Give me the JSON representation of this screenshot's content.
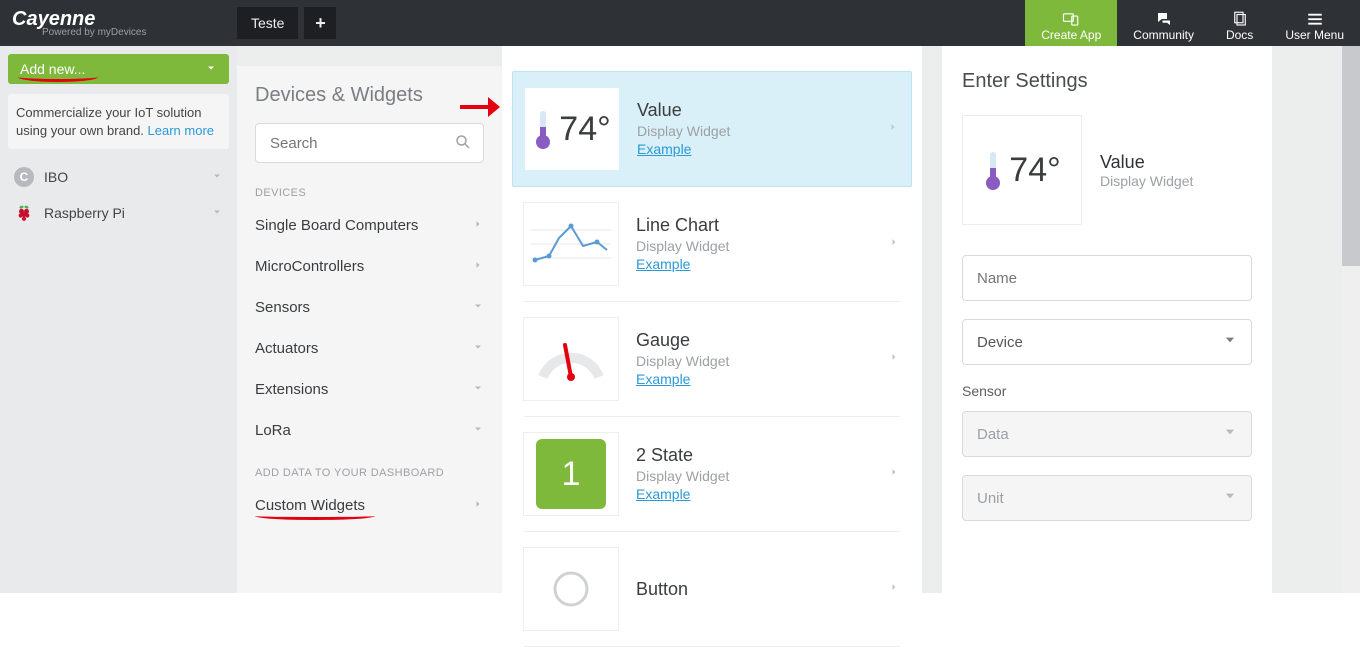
{
  "header": {
    "brand": "Cayenne",
    "tagline": "Powered by myDevices",
    "tab": "Teste",
    "menu": {
      "create": "Create App",
      "community": "Community",
      "docs": "Docs",
      "user": "User Menu"
    }
  },
  "sidebar": {
    "add_new": "Add new...",
    "info_text": "Commercialize your IoT solution using your own brand. ",
    "info_link": "Learn more",
    "items": [
      {
        "label": "IBO",
        "icon": "C"
      },
      {
        "label": "Raspberry Pi",
        "icon": "rasp"
      }
    ]
  },
  "col1": {
    "title": "Devices & Widgets",
    "search_placeholder": "Search",
    "devices_label": "DEVICES",
    "categories": [
      "Single Board Computers",
      "MicroControllers",
      "Sensors",
      "Actuators",
      "Extensions",
      "LoRa"
    ],
    "data_label": "ADD DATA TO YOUR DASHBOARD",
    "custom": "Custom Widgets"
  },
  "col2": {
    "widgets": [
      {
        "title": "Value",
        "sub": "Display Widget",
        "ex": "Example",
        "type": "temp",
        "val": "74°"
      },
      {
        "title": "Line Chart",
        "sub": "Display Widget",
        "ex": "Example",
        "type": "chart"
      },
      {
        "title": "Gauge",
        "sub": "Display Widget",
        "ex": "Example",
        "type": "gauge"
      },
      {
        "title": "2 State",
        "sub": "Display Widget",
        "ex": "Example",
        "type": "tstate",
        "val": "1"
      },
      {
        "title": "Button",
        "sub": "",
        "ex": "",
        "type": "button"
      }
    ]
  },
  "col3": {
    "title": "Enter Settings",
    "preview": {
      "title": "Value",
      "sub": "Display Widget",
      "val": "74°"
    },
    "name_placeholder": "Name",
    "device_label": "Device",
    "sensor_label": "Sensor",
    "data_label": "Data",
    "unit_label": "Unit"
  }
}
